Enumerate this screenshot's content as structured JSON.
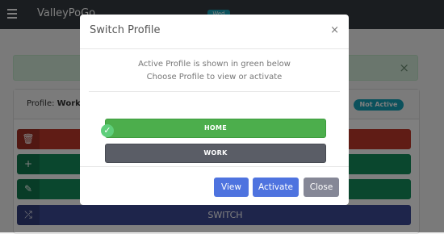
{
  "navbar": {
    "brand": "ValleyPoGo",
    "badge": "Wed"
  },
  "alert": {
    "close": "×"
  },
  "card": {
    "profile_prefix": "Profile:",
    "profile_name": "Work",
    "status": "Not Active",
    "buttons": [
      {
        "icon": "trash-icon",
        "label": ""
      },
      {
        "icon": "plus-icon",
        "label": ""
      },
      {
        "icon": "edit-icon",
        "label": ""
      },
      {
        "icon": "shuffle-icon",
        "label": "SWITCH"
      }
    ]
  },
  "modal": {
    "title": "Switch Profile",
    "close": "×",
    "message_line1": "Active Profile is shown in green below",
    "message_line2": "Choose Profile to view or activate",
    "profiles": [
      {
        "label": "HOME",
        "color": "#4cae4c",
        "active": true
      },
      {
        "label": "WORK",
        "color": "#5a5d66",
        "active": false,
        "selected": true
      }
    ],
    "check": "✓",
    "footer": {
      "view": "View",
      "activate": "Activate",
      "close": "Close"
    }
  },
  "colors": {
    "primary": "#4e73df",
    "secondary": "#858796",
    "success": "#4cae4c",
    "info": "#17a2b8",
    "danger": "#c0392b"
  }
}
